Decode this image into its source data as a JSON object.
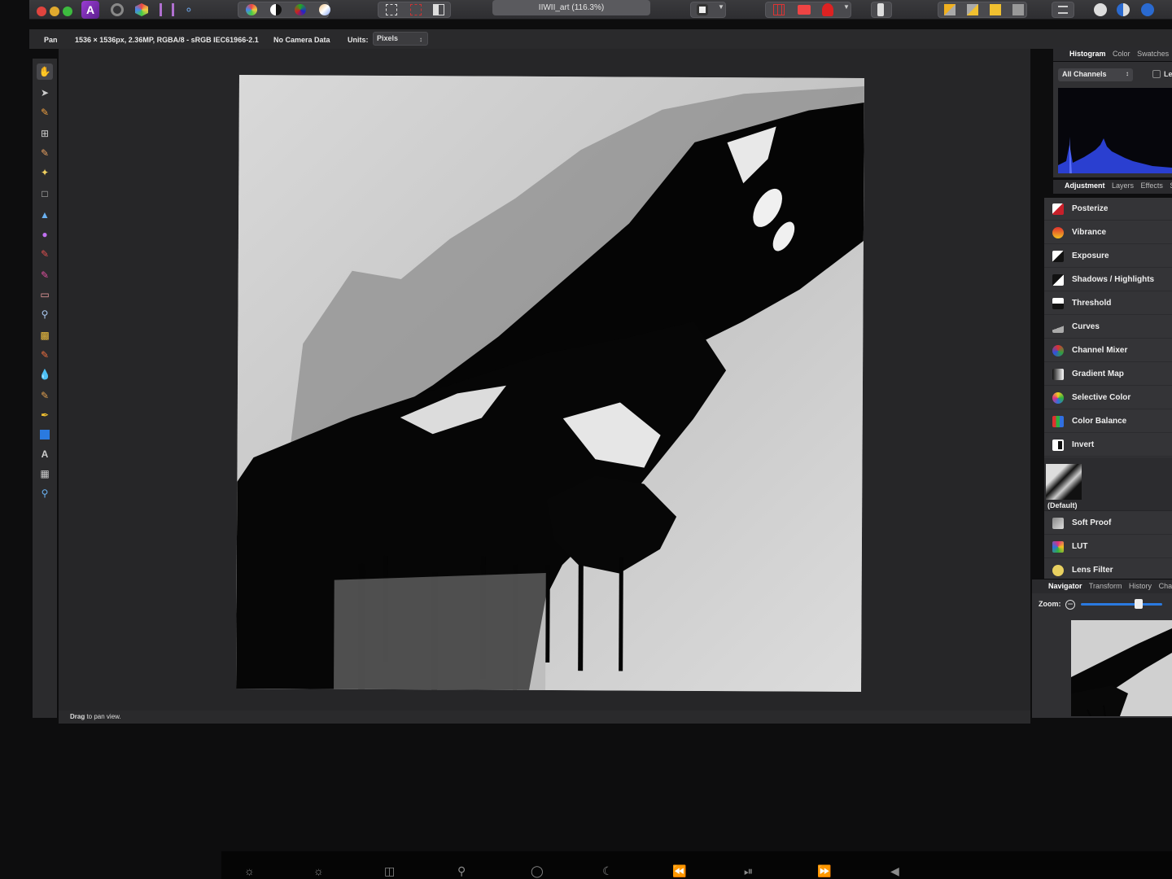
{
  "toolbar": {
    "app_name": "Affinity Photo",
    "document_title": "IIWII_art (116.3%)"
  },
  "context": {
    "tool_name": "Pan",
    "document_info": "1536 × 1536px, 2.36MP, RGBA/8 - sRGB IEC61966-2.1",
    "camera_data": "No Camera Data",
    "units_label": "Units:",
    "units_value": "Pixels"
  },
  "status_bar": {
    "bold": "Drag",
    "text": " to pan view."
  },
  "histogram_panel": {
    "tabs": [
      "Histogram",
      "Color",
      "Swatches"
    ],
    "selected_tab": "Histogram",
    "channel": "All Channels",
    "partial_label": "Le"
  },
  "adjustment_panel": {
    "tabs": [
      "Adjustment",
      "Layers",
      "Effects",
      "S"
    ],
    "selected_tab": "Adjustment",
    "items": [
      {
        "label": "Posterize",
        "icon": "posterize-icon",
        "color": "#c8202a"
      },
      {
        "label": "Vibrance",
        "icon": "vibrance-icon",
        "color": "#e8a020"
      },
      {
        "label": "Exposure",
        "icon": "exposure-icon",
        "color": "#dddddd"
      },
      {
        "label": "Shadows / Highlights",
        "icon": "shadows-highlights-icon",
        "color": "#eeeeee"
      },
      {
        "label": "Threshold",
        "icon": "threshold-icon",
        "color": "#bbbbbb"
      },
      {
        "label": "Curves",
        "icon": "curves-icon",
        "color": "#999999"
      },
      {
        "label": "Channel Mixer",
        "icon": "channel-mixer-icon",
        "color": "#3aa04a"
      },
      {
        "label": "Gradient Map",
        "icon": "gradient-map-icon",
        "color": "#aaaaaa"
      },
      {
        "label": "Selective Color",
        "icon": "selective-color-icon",
        "color": "#e0c020"
      },
      {
        "label": "Color Balance",
        "icon": "color-balance-icon",
        "color": "#3a78d0"
      },
      {
        "label": "Invert",
        "icon": "invert-icon",
        "color": "#ffffff"
      }
    ],
    "preset_label": "(Default)",
    "items_after": [
      {
        "label": "Soft Proof",
        "icon": "soft-proof-icon",
        "color": "#888888"
      },
      {
        "label": "LUT",
        "icon": "lut-icon",
        "color": "#d04a8a"
      },
      {
        "label": "Lens Filter",
        "icon": "lens-filter-icon",
        "color": "#e8d060"
      }
    ]
  },
  "navigator_panel": {
    "tabs": [
      "Navigator",
      "Transform",
      "History",
      "Chan"
    ],
    "selected_tab": "Navigator",
    "zoom_label": "Zoom:"
  }
}
